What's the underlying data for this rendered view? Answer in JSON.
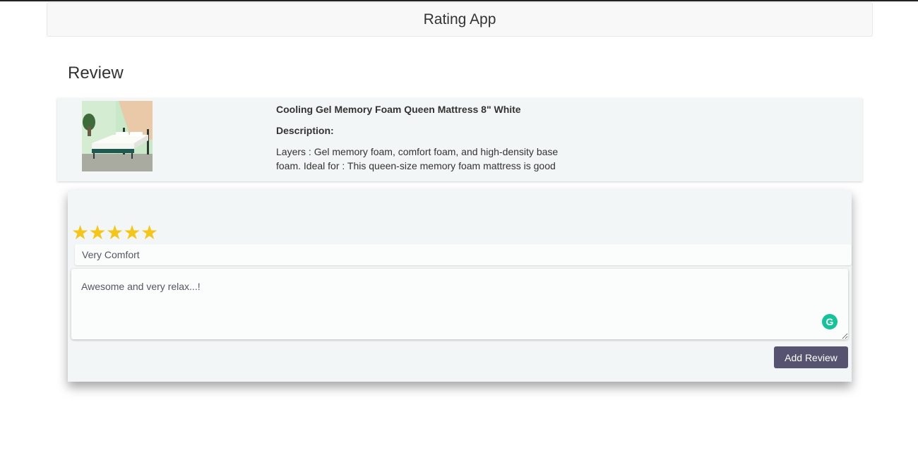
{
  "navbar": {
    "brand": "Rating App"
  },
  "page": {
    "heading": "Review"
  },
  "product": {
    "title": "Cooling Gel Memory Foam Queen Mattress 8\" White",
    "description_label": "Description:",
    "description": "Layers : Gel memory foam, comfort foam, and high-density base foam. Ideal for : This queen-size memory foam mattress is good"
  },
  "review": {
    "rating": 5,
    "max_rating": 5,
    "stars": [
      "★",
      "★",
      "★",
      "★",
      "★"
    ],
    "title_value": "Very Comfort",
    "body_value": "Awesome and very relax...!",
    "submit_label": "Add Review"
  },
  "colors": {
    "star": "#f5c518",
    "button": "#555370",
    "grammarly": "#15c39a"
  },
  "icons": {
    "grammarly": "grammarly-icon"
  }
}
